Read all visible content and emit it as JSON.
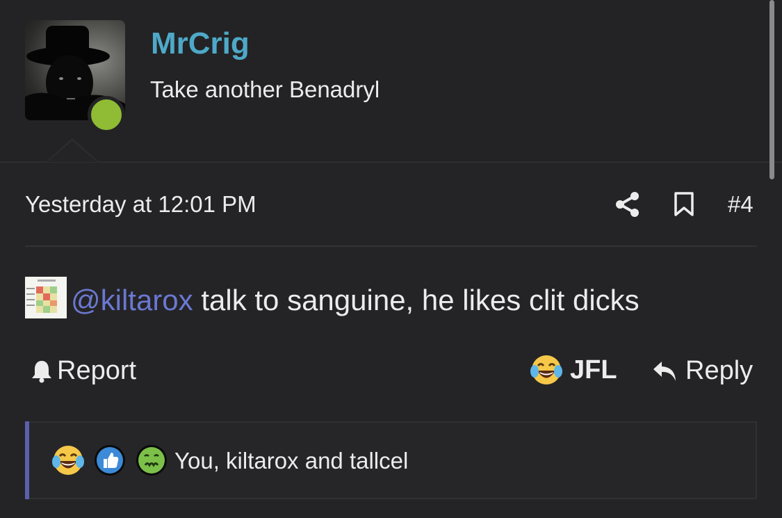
{
  "author": {
    "username": "MrCrig",
    "user_title": "Take another Benadryl",
    "online": true
  },
  "post": {
    "timestamp": "Yesterday at 12:01 PM",
    "number": "#4",
    "mention": "@kiltarox",
    "text": " talk to sanguine, he likes clit dicks"
  },
  "actions": {
    "report_label": "Report",
    "reaction_label": "JFL",
    "reply_label": "Reply"
  },
  "reactions": {
    "icons": [
      "laughing-crying-icon",
      "thumbs-up-icon",
      "nauseated-icon"
    ],
    "summary": "You, kiltarox and tallcel"
  },
  "colors": {
    "background": "#242426",
    "username": "#4ea9c8",
    "mention": "#6b78d1",
    "online": "#8fbc34",
    "accent": "#5a5fb0"
  }
}
